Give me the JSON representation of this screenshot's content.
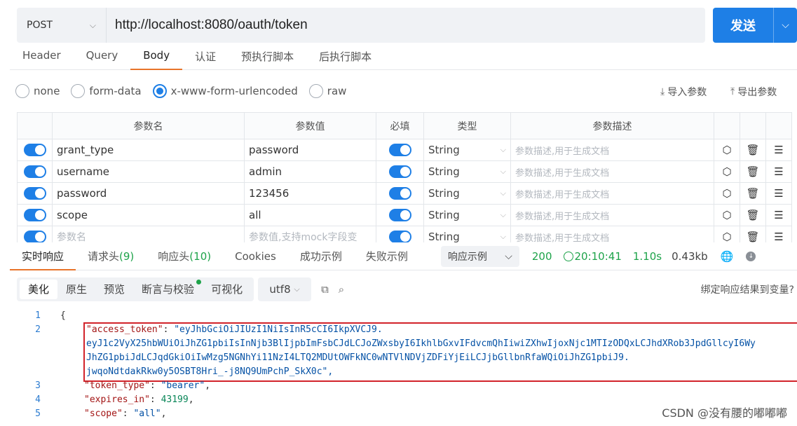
{
  "request": {
    "method": "POST",
    "url": "http://localhost:8080/oauth/token",
    "send_label": "发送"
  },
  "req_tabs": [
    "Header",
    "Query",
    "Body",
    "认证",
    "预执行脚本",
    "后执行脚本"
  ],
  "body_types": [
    "none",
    "form-data",
    "x-www-form-urlencoded",
    "raw"
  ],
  "import_label": "导入参数",
  "export_label": "导出参数",
  "params": {
    "headers": [
      "参数名",
      "参数值",
      "必填",
      "类型",
      "参数描述"
    ],
    "rows": [
      {
        "name": "grant_type",
        "value": "password",
        "type": "String",
        "desc": "参数描述,用于生成文档"
      },
      {
        "name": "username",
        "value": "admin",
        "type": "String",
        "desc": "参数描述,用于生成文档"
      },
      {
        "name": "password",
        "value": "123456",
        "type": "String",
        "desc": "参数描述,用于生成文档"
      },
      {
        "name": "scope",
        "value": "all",
        "type": "String",
        "desc": "参数描述,用于生成文档"
      },
      {
        "name": "参数名",
        "value": "参数值,支持mock字段变",
        "type": "String",
        "desc": "参数描述,用于生成文档"
      }
    ]
  },
  "resp_tabs": {
    "realtime": "实时响应",
    "req_headers": "请求头",
    "req_headers_count": "(9)",
    "resp_headers": "响应头",
    "resp_headers_count": "(10)",
    "cookies": "Cookies",
    "success": "成功示例",
    "fail": "失败示例"
  },
  "example_select": "响应示例",
  "status": {
    "code": "200",
    "time": "20:10:41",
    "duration": "1.10s",
    "size": "0.43kb"
  },
  "view_modes": [
    "美化",
    "原生",
    "预览",
    "断言与校验",
    "可视化"
  ],
  "encoding": "utf8",
  "bind_var": "绑定响应结果到变量?",
  "code": {
    "line_numbers": [
      "1",
      "2",
      "3",
      "4",
      "5"
    ],
    "open_brace": "{",
    "access_token_key": "\"access_token\"",
    "token_lines": [
      "\"eyJhbGciOiJIUzI1NiIsInR5cCI6IkpXVCJ9.",
      "eyJ1c2VyX25hbWUiOiJhZG1pbiIsInNjb3BlIjpbImFsbCJdLCJoZWxsbyI6IkhlbGxvIFdvcmQhIiwiZXhwIjoxNjc1MTIzODQxLCJhdXRob3JpdGllcyI6WyJhZG1pbiJdLCJqdGkiOiIwMzg5NGNhYi11NzI4LTQ2MDUtOWFkNC0wNTVlNDVjZDFiYjEiLCJjbGllbnRfaWQiOiJhZG1pbiJ9.",
      "jwqoNdtdakRkw0y5OSBT8Hri_-j8NQ9UmPchP_SkX0c\","
    ],
    "token_type_key": "\"token_type\"",
    "token_type_val": "\"bearer\"",
    "expires_key": "\"expires_in\"",
    "expires_val": "43199",
    "scope_key": "\"scope\"",
    "scope_val": "\"all\""
  },
  "watermark": "CSDN @没有腰的嘟嘟嘟",
  "colors": {
    "accent": "#1e7fe6",
    "tab_underline": "#e8742a",
    "success": "#1ea34a",
    "highlight_box": "#d2232a"
  }
}
